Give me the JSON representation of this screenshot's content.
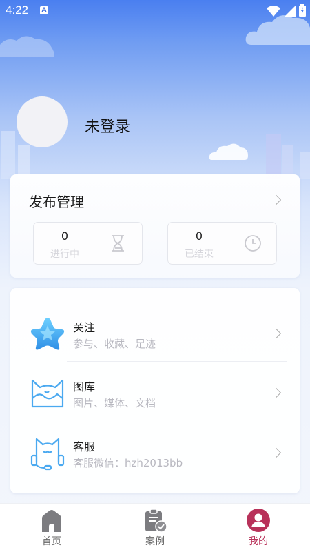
{
  "status_bar": {
    "time": "4:22",
    "badge": "A"
  },
  "profile": {
    "username": "未登录"
  },
  "publish": {
    "title": "发布管理",
    "stats": [
      {
        "count": "0",
        "label": "进行中",
        "icon": "hourglass-icon"
      },
      {
        "count": "0",
        "label": "已结束",
        "icon": "clock-icon"
      }
    ]
  },
  "menu": {
    "items": [
      {
        "title": "关注",
        "subtitle": "参与、收藏、足迹",
        "icon": "star-icon"
      },
      {
        "title": "图库",
        "subtitle": "图片、媒体、文档",
        "icon": "cat-image-icon"
      },
      {
        "title": "客服",
        "subtitle": "客服微信：hzh2013bb",
        "icon": "cat-headset-icon"
      }
    ]
  },
  "tabbar": {
    "tabs": [
      {
        "label": "首页",
        "icon": "home-icon",
        "active": false
      },
      {
        "label": "案例",
        "icon": "clipboard-check-icon",
        "active": false
      },
      {
        "label": "我的",
        "icon": "user-icon",
        "active": true
      }
    ]
  },
  "colors": {
    "active_tab": "#b8325a",
    "header_blue": "#4a7ff0",
    "icon_blue": "#4aa9f0"
  }
}
